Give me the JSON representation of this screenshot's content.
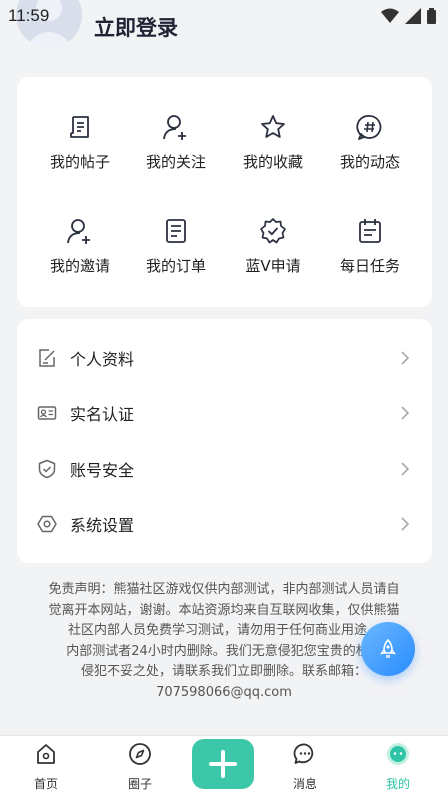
{
  "status_bar": {
    "time": "11:59"
  },
  "header": {
    "login_label": "立即登录"
  },
  "grid": [
    {
      "label": "我的帖子",
      "icon": "post-icon"
    },
    {
      "label": "我的关注",
      "icon": "follow-icon"
    },
    {
      "label": "我的收藏",
      "icon": "star-icon"
    },
    {
      "label": "我的动态",
      "icon": "hashtag-icon"
    },
    {
      "label": "我的邀请",
      "icon": "invite-icon"
    },
    {
      "label": "我的订单",
      "icon": "order-icon"
    },
    {
      "label": "蓝V申请",
      "icon": "verified-icon"
    },
    {
      "label": "每日任务",
      "icon": "calendar-icon"
    }
  ],
  "menu": [
    {
      "label": "个人资料",
      "icon": "edit-profile-icon"
    },
    {
      "label": "实名认证",
      "icon": "id-card-icon"
    },
    {
      "label": "账号安全",
      "icon": "shield-icon"
    },
    {
      "label": "系统设置",
      "icon": "settings-icon"
    }
  ],
  "disclaimer": {
    "lines": [
      "免责声明：熊猫社区游戏仅供内部测试，非内部测试人员请自",
      "觉离开本网站，谢谢。本站资源均来自互联网收集，仅供熊猫",
      "社区内部人员免费学习测试，请勿用于任何商业用途。",
      "内部测试者24小时内删除。我们无意侵犯您宝贵的权益",
      "侵犯不妥之处，请联系我们立即删除。联系邮箱：",
      "707598066@qq.com"
    ]
  },
  "tabbar": {
    "items": [
      {
        "label": "首页",
        "icon": "home-icon"
      },
      {
        "label": "圈子",
        "icon": "compass-icon"
      },
      {
        "label": "消息",
        "icon": "message-icon"
      },
      {
        "label": "我的",
        "icon": "profile-icon"
      }
    ],
    "active": "我的",
    "active_color": "#2ec4a6"
  },
  "colors": {
    "accent": "#3cc8a8",
    "fab": "#2a8cff"
  }
}
